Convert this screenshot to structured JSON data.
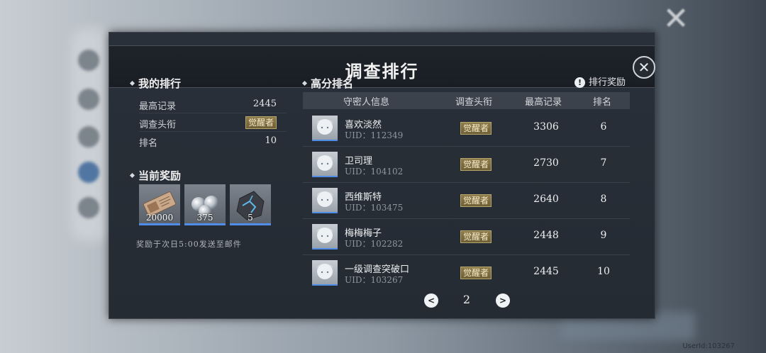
{
  "window": {
    "title": "调查排行",
    "watermark": "UserId:103267"
  },
  "my_rank": {
    "title": "我的排行",
    "rows": [
      {
        "label": "最高记录",
        "value": "2445"
      },
      {
        "label": "调查头衔",
        "value": "觉醒者"
      },
      {
        "label": "排名",
        "value": "10"
      }
    ]
  },
  "rewards": {
    "title": "当前奖励",
    "items": [
      {
        "icon": "ticket-icon",
        "qty": "20000"
      },
      {
        "icon": "orb-icon",
        "qty": "375"
      },
      {
        "icon": "crystal-ore-icon",
        "qty": "5"
      }
    ],
    "note": "奖励于次日5:00发送至邮件"
  },
  "leaderboard": {
    "title": "高分排名",
    "reward_link": "排行奖励",
    "headers": {
      "player": "守密人信息",
      "title": "调查头衔",
      "score": "最高记录",
      "rank": "排名"
    },
    "rows": [
      {
        "name": "喜欢淡然",
        "uid": "UID：112349",
        "title": "觉醒者",
        "score": "3306",
        "rank": "6"
      },
      {
        "name": "卫司理",
        "uid": "UID：104102",
        "title": "觉醒者",
        "score": "2730",
        "rank": "7"
      },
      {
        "name": "西维斯特",
        "uid": "UID：103475",
        "title": "觉醒者",
        "score": "2640",
        "rank": "8"
      },
      {
        "name": "梅梅梅子",
        "uid": "UID：102282",
        "title": "觉醒者",
        "score": "2448",
        "rank": "9"
      },
      {
        "name": "一级调查突破口",
        "uid": "UID：103267",
        "title": "觉醒者",
        "score": "2445",
        "rank": "10"
      }
    ],
    "page": "2"
  },
  "colors": {
    "accent_blue": "#4f8de6",
    "badge_gold": "#8f7d4c",
    "panel_bg": "#252b33"
  }
}
